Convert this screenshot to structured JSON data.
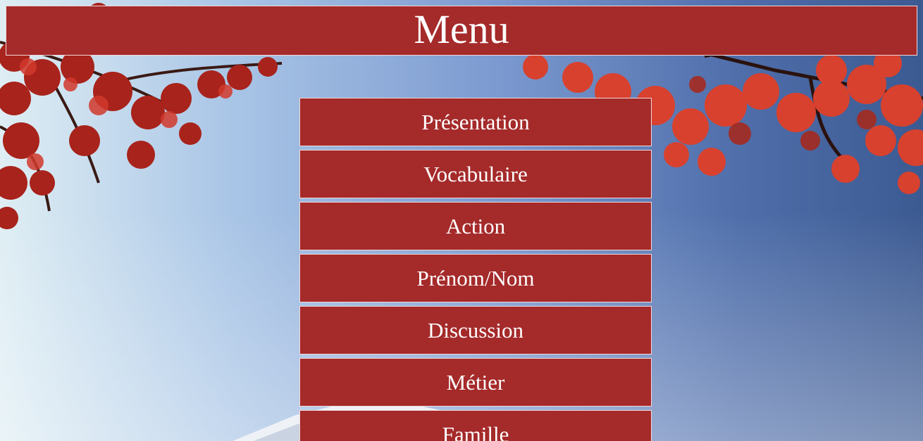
{
  "header": {
    "title": "Menu"
  },
  "menu": {
    "items": [
      {
        "label": "Présentation"
      },
      {
        "label": "Vocabulaire"
      },
      {
        "label": "Action"
      },
      {
        "label": "Prénom/Nom"
      },
      {
        "label": "Discussion"
      },
      {
        "label": "Métier"
      },
      {
        "label": "Famille"
      }
    ]
  },
  "colors": {
    "accent": "#a52a2a",
    "border": "#f2d8d8",
    "text": "#ffffff"
  },
  "icons": [
    "maple-leaves-background-image"
  ]
}
